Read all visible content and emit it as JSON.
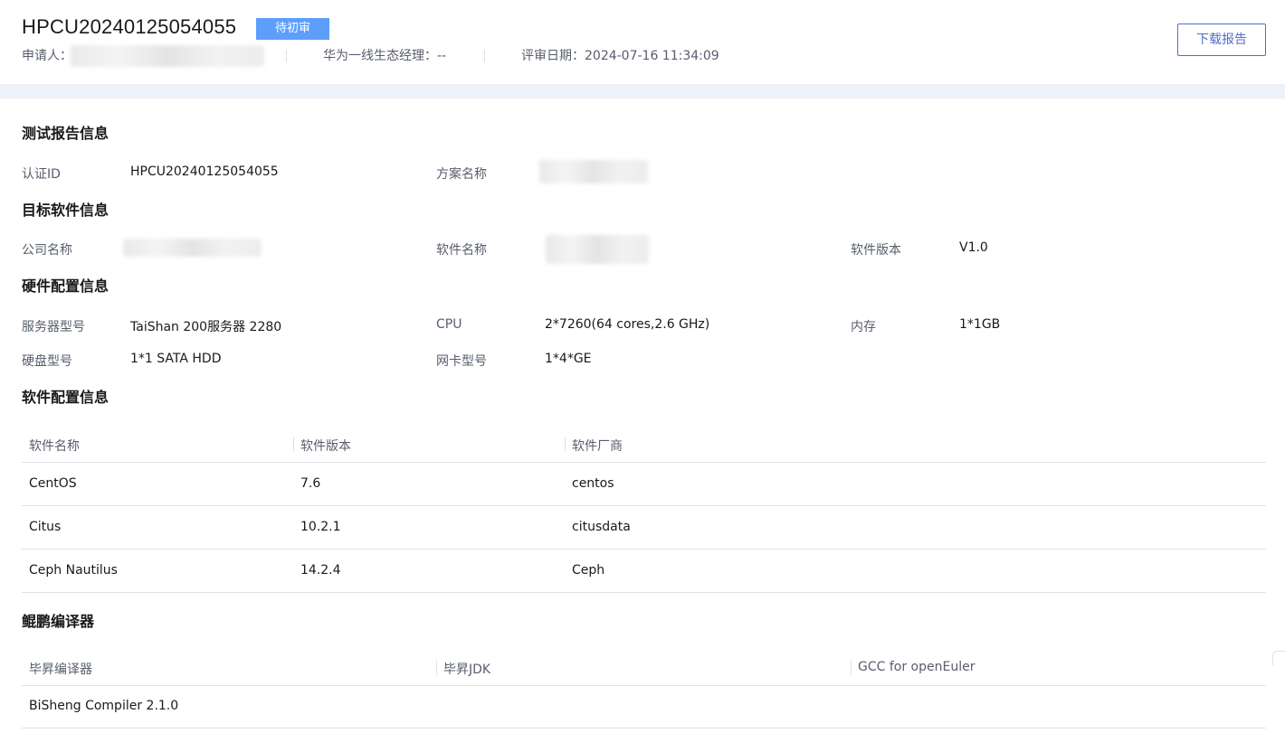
{
  "header": {
    "id_title": "HPCU20240125054055",
    "status_tag": "待初审",
    "applicant_label": "申请人：",
    "manager_label": "华为一线生态经理：",
    "manager_value": "--",
    "review_date_label": "评审日期：",
    "review_date_value": "2024-07-16 11:34:09",
    "download_button": "下载报告"
  },
  "report_info": {
    "title": "测试报告信息",
    "cert_id_label": "认证ID",
    "cert_id_value": "HPCU20240125054055",
    "plan_name_label": "方案名称"
  },
  "target_software": {
    "title": "目标软件信息",
    "company_label": "公司名称",
    "software_name_label": "软件名称",
    "software_version_label": "软件版本",
    "software_version_value": "V1.0"
  },
  "hardware": {
    "title": "硬件配置信息",
    "server_label": "服务器型号",
    "server_value": "TaiShan 200服务器 2280",
    "cpu_label": "CPU",
    "cpu_value": "2*7260(64 cores,2.6 GHz)",
    "memory_label": "内存",
    "memory_value": "1*1GB",
    "disk_label": "硬盘型号",
    "disk_value": "1*1 SATA HDD",
    "nic_label": "网卡型号",
    "nic_value": "1*4*GE"
  },
  "software_config": {
    "title": "软件配置信息",
    "columns": [
      "软件名称",
      "软件版本",
      "软件厂商"
    ],
    "rows": [
      [
        "CentOS",
        "7.6",
        "centos"
      ],
      [
        "Citus",
        "10.2.1",
        "citusdata"
      ],
      [
        "Ceph Nautilus",
        "14.2.4",
        "Ceph"
      ]
    ]
  },
  "compiler": {
    "title": "鲲鹏编译器",
    "columns": [
      "毕昇编译器",
      "毕昇JDK",
      "GCC for openEuler"
    ],
    "rows": [
      [
        "BiSheng Compiler 2.1.0",
        "",
        ""
      ]
    ]
  }
}
